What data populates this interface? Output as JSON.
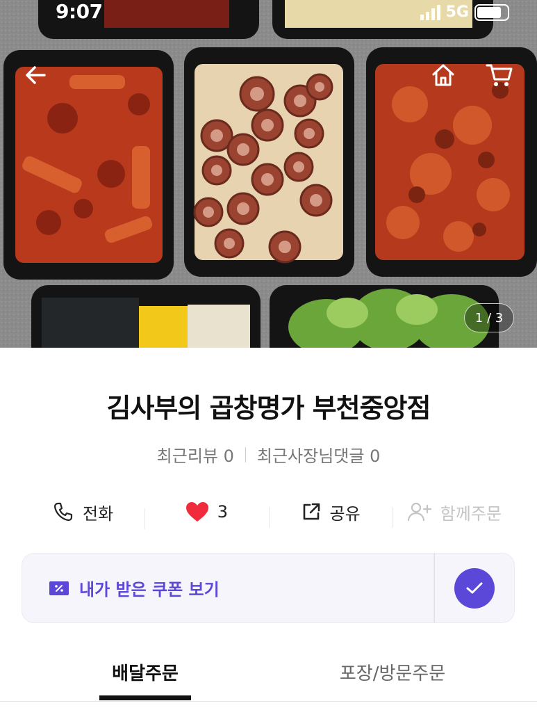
{
  "status": {
    "time": "9:07",
    "network": "5G",
    "battery_level": 0.8
  },
  "hero": {
    "page_indicator": "1 / 3",
    "icons": {
      "back": "arrow-left-icon",
      "home": "home-icon",
      "cart": "cart-icon"
    }
  },
  "store": {
    "name": "김사부의 곱창명가 부천중앙점",
    "recent_reviews": "최근리뷰 0",
    "recent_owner_comments": "최근사장님댓글 0"
  },
  "actions": {
    "call": "전화",
    "like_count": "3",
    "share": "공유",
    "group_order": "함께주문"
  },
  "coupon": {
    "label": "내가 받은 쿠폰 보기",
    "accent": "#5b47d8"
  },
  "tabs": {
    "delivery": "배달주문",
    "pickup": "포장/방문주문"
  }
}
